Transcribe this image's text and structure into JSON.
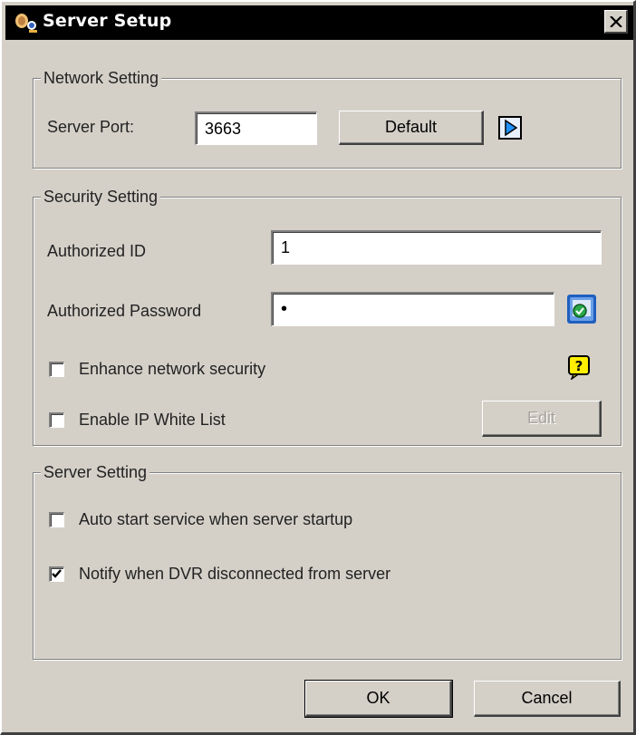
{
  "window": {
    "title": "Server Setup",
    "close_glyph": "✕"
  },
  "network": {
    "legend": "Network Setting",
    "port_label": "Server Port:",
    "port_value": "3663",
    "default_button": "Default",
    "arrow_icon": "play-arrow-icon"
  },
  "security": {
    "legend": "Security Setting",
    "id_label": "Authorized ID",
    "id_value": "1",
    "password_label": "Authorized Password",
    "password_value": "•",
    "enhance_label": "Enhance network security",
    "enhance_checked": false,
    "whitelist_label": "Enable IP White List",
    "whitelist_checked": false,
    "edit_button": "Edit",
    "help_icon": "help-question-icon",
    "password_icon": "password-reveal-icon"
  },
  "server": {
    "legend": "Server Setting",
    "autostart_label": "Auto start service when server startup",
    "autostart_checked": false,
    "notify_label": "Notify when DVR disconnected from server",
    "notify_checked": true
  },
  "footer": {
    "ok_button": "OK",
    "cancel_button": "Cancel"
  },
  "colors": {
    "window_bg": "#d4d0c8",
    "titlebar_bg": "#000000",
    "accent_green": "#2aa84a",
    "accent_blue": "#1f5fbf",
    "help_yellow": "#ffee00"
  }
}
